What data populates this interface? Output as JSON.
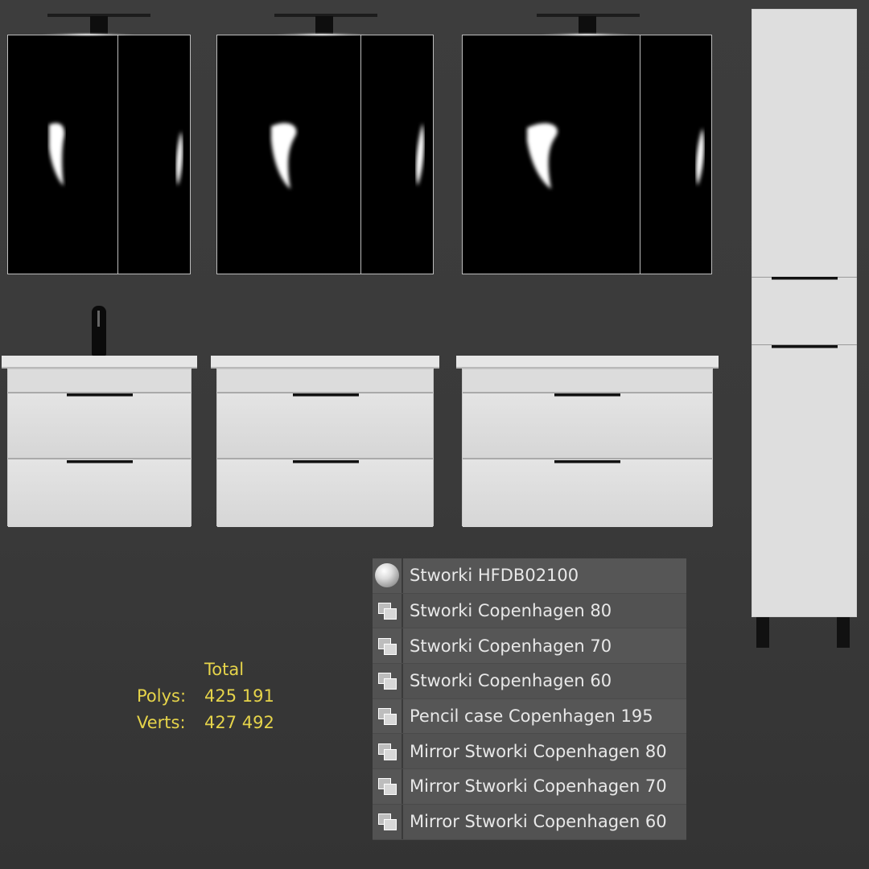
{
  "stats": {
    "header": "Total",
    "polys_label": "Polys:",
    "polys_value": "425 191",
    "verts_label": "Verts:",
    "verts_value": "427 492"
  },
  "layers": [
    {
      "label": "Stworki HFDB02100",
      "icon": "sphere-icon"
    },
    {
      "label": "Stworki Copenhagen 80",
      "icon": "object-group-icon"
    },
    {
      "label": "Stworki Copenhagen 70",
      "icon": "object-group-icon"
    },
    {
      "label": "Stworki Copenhagen 60",
      "icon": "object-group-icon"
    },
    {
      "label": "Pencil case Copenhagen 195",
      "icon": "object-group-icon"
    },
    {
      "label": "Mirror Stworki Copenhagen 80",
      "icon": "object-group-icon"
    },
    {
      "label": "Mirror Stworki Copenhagen 70",
      "icon": "object-group-icon"
    },
    {
      "label": "Mirror Stworki Copenhagen 60",
      "icon": "object-group-icon"
    }
  ],
  "colors": {
    "viewport_bg": "#3b3b3b",
    "stats_text": "#e6d44a",
    "cabinet_white": "#dcdcdc",
    "mirror_black": "#000000"
  }
}
